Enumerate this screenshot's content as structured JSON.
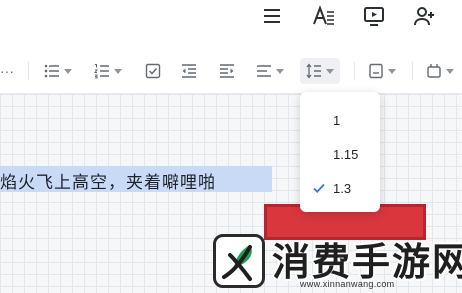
{
  "top_icons": [
    "hamburger-menu-icon",
    "text-style-icon",
    "present-icon",
    "add-user-icon"
  ],
  "toolbar": {
    "overflow_label": "···",
    "icons": [
      "bullet-list-icon",
      "numbered-list-icon",
      "checkbox-list-icon",
      "outdent-icon",
      "indent-icon",
      "align-icon",
      "line-spacing-icon",
      "insert-block-icon",
      "insert-widget-icon"
    ]
  },
  "document": {
    "selected_text": "焰火飞上高空，夹着噼哩啪"
  },
  "line_spacing_menu": {
    "options": [
      "1",
      "1.15",
      "1.3"
    ],
    "selected": "1.3"
  },
  "watermark": {
    "title": "消费手游网",
    "url": "www.xinnanwang.com"
  },
  "colors": {
    "selection": "#c8daf6",
    "check": "#3370ff",
    "red_block": "#d9363e",
    "watermark_green": "#1aa34a"
  }
}
